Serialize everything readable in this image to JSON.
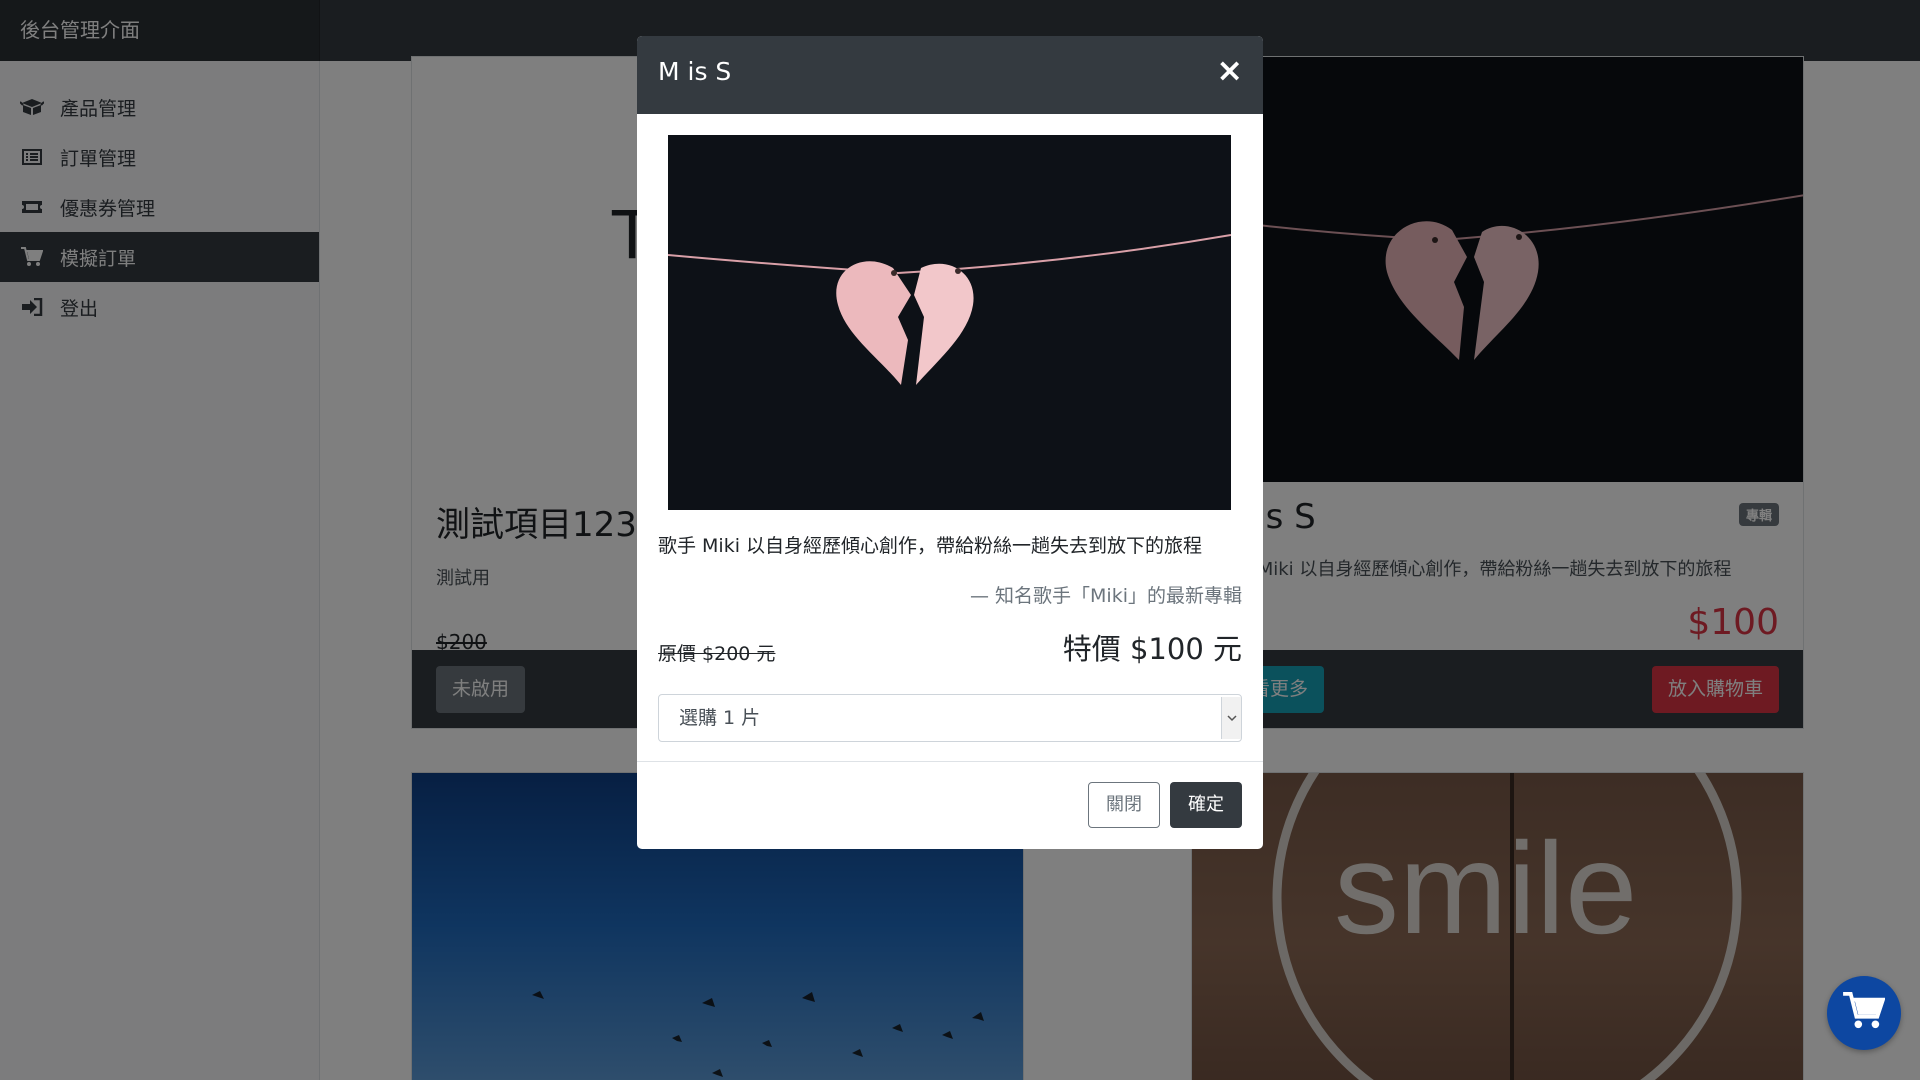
{
  "navbar": {
    "brand": "後台管理介面"
  },
  "sidebar": {
    "items": [
      {
        "label": "產品管理",
        "icon": "box-open-icon"
      },
      {
        "label": "訂單管理",
        "icon": "list-icon"
      },
      {
        "label": "優惠券管理",
        "icon": "ticket-icon"
      },
      {
        "label": "模擬訂單",
        "icon": "cart-icon",
        "active": true
      },
      {
        "label": "登出",
        "icon": "sign-out-icon"
      }
    ]
  },
  "products": {
    "card1": {
      "title": "測試項目123",
      "desc": "測試用",
      "origin_price": "$200",
      "image_text": "T",
      "status_button": "未啟用"
    },
    "card2": {
      "title": "M is S",
      "badge": "專輯",
      "desc": "歌手 Miki 以自身經歷傾心創作，帶給粉絲一趟失去到放下的旅程",
      "price": "$100",
      "more_button": "查看更多",
      "cart_button": "放入購物車"
    },
    "card4": {
      "image_text": "smile"
    }
  },
  "modal": {
    "title": "M is S",
    "close_symbol": "×",
    "description": "歌手 Miki 以自身經歷傾心創作，帶給粉絲一趟失去到放下的旅程",
    "quote": "— 知名歌手「Miki」的最新專輯",
    "original_price": "原價 $200 元",
    "sale_price": "特價 $100 元",
    "quantity": {
      "selected": "選購 1 片"
    },
    "close_button": "關閉",
    "confirm_button": "確定"
  },
  "colors": {
    "dark": "#343a40",
    "danger": "#dc3545",
    "info": "#17a2b8",
    "secondary": "#6c757d",
    "fab": "#0d47a1"
  }
}
